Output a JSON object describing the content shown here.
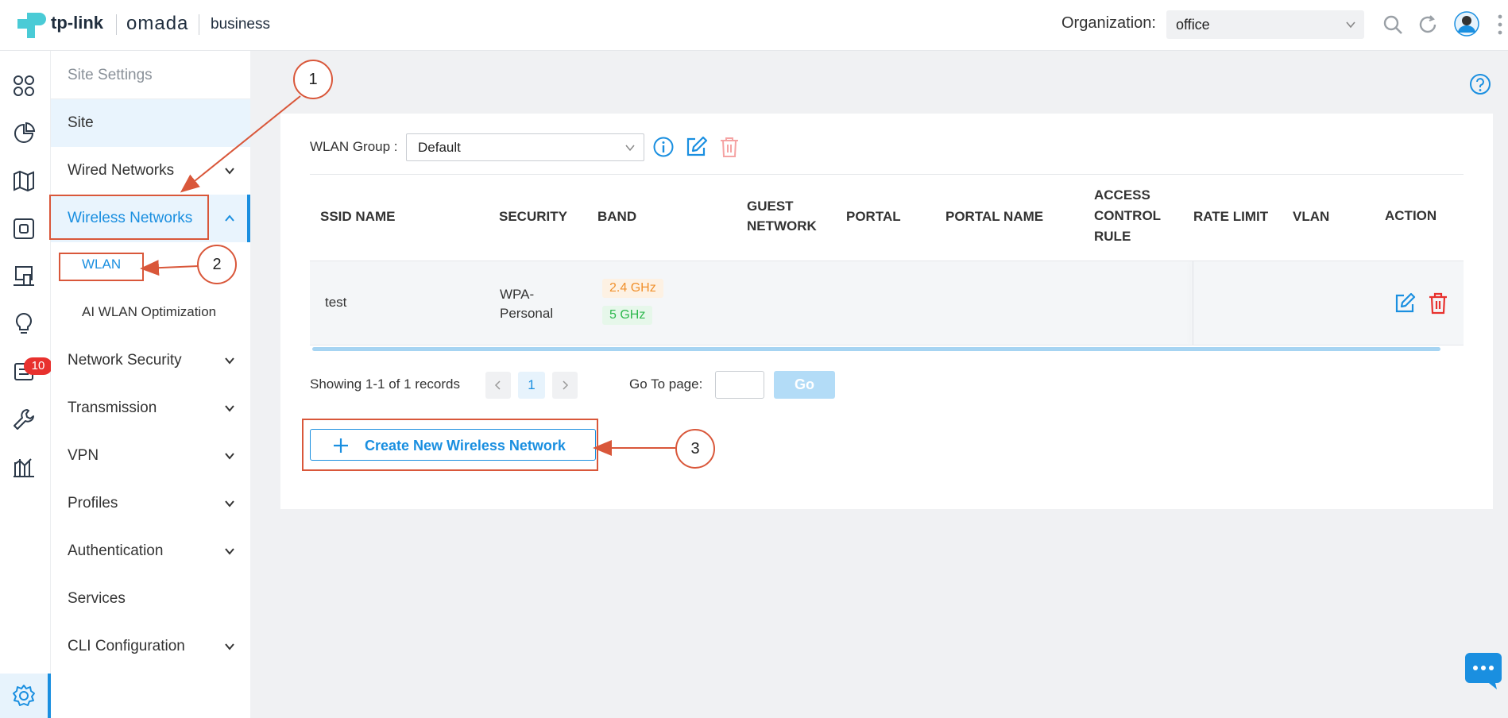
{
  "header": {
    "brand_tplink": "tp-link",
    "brand_omada": "omada",
    "brand_business": "business",
    "org_label": "Organization:",
    "org_value": "office"
  },
  "rail": {
    "icons": [
      "dashboard-icon",
      "statistics-icon",
      "map-icon",
      "devices-icon",
      "clients-icon",
      "insights-icon",
      "logs-icon",
      "tools-icon",
      "reports-icon",
      "settings-icon"
    ],
    "logs_badge": "10"
  },
  "sidebar": {
    "section_title": "Site Settings",
    "items": [
      {
        "label": "Site"
      },
      {
        "label": "Wired Networks"
      },
      {
        "label": "Wireless Networks"
      },
      {
        "label": "Network Security"
      },
      {
        "label": "Transmission"
      },
      {
        "label": "VPN"
      },
      {
        "label": "Profiles"
      },
      {
        "label": "Authentication"
      },
      {
        "label": "Services"
      },
      {
        "label": "CLI Configuration"
      }
    ],
    "sub_items": [
      {
        "label": "WLAN"
      },
      {
        "label": "AI WLAN Optimization"
      }
    ]
  },
  "wlan_group": {
    "label": "WLAN Group :",
    "value": "Default"
  },
  "table": {
    "headers": {
      "ssid": "SSID NAME",
      "security": "SECURITY",
      "band": "BAND",
      "guest_1": "GUEST",
      "guest_2": "NETWORK",
      "portal": "PORTAL",
      "portal_name": "PORTAL NAME",
      "acr_1": "ACCESS",
      "acr_2": "CONTROL",
      "acr_3": "RULE",
      "rate": "RATE LIMIT",
      "vlan": "VLAN",
      "action": "ACTION"
    },
    "rows": [
      {
        "ssid": "test",
        "security_1": "WPA-",
        "security_2": "Personal",
        "band_1": "2.4 GHz",
        "band_2": "5 GHz"
      }
    ]
  },
  "pagination": {
    "summary": "Showing 1-1 of 1 records",
    "current_page": "1",
    "goto_label": "Go To page:",
    "go_button": "Go"
  },
  "create_button": "Create New Wireless Network",
  "annotations": [
    "1",
    "2",
    "3"
  ],
  "colors": {
    "accent": "#1a8fe0",
    "annotation": "#d9573a",
    "band_24": "#f0902c",
    "band_5": "#2db84d",
    "delete": "#e8312e"
  }
}
